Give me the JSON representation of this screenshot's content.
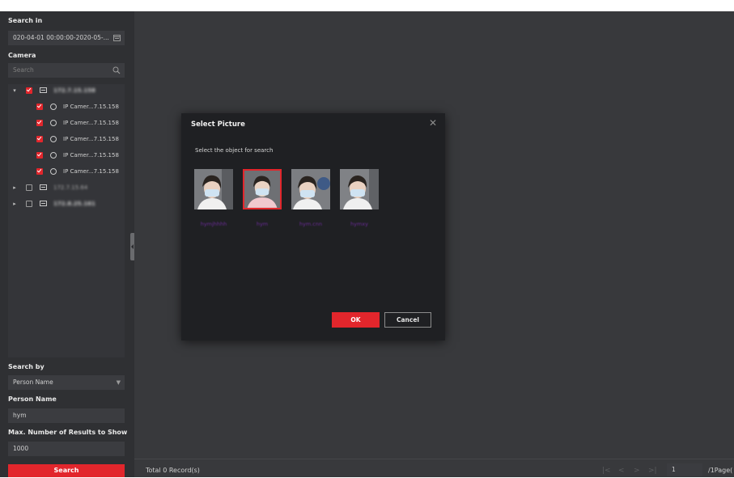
{
  "sidebar": {
    "search_in_label": "Search in",
    "date_range": "020-04-01 00:00:00-2020-05-...",
    "camera_label": "Camera",
    "camera_search_placeholder": "Search",
    "tree": [
      {
        "label": "172.7.15.158",
        "type": "folder",
        "expanded": true,
        "checked": true,
        "level": 0
      },
      {
        "label": "IP Camer...7.15.158",
        "type": "camera",
        "checked": true,
        "level": 1
      },
      {
        "label": "IP Camer...7.15.158",
        "type": "camera",
        "checked": true,
        "level": 1
      },
      {
        "label": "IP Camer...7.15.158",
        "type": "camera",
        "checked": true,
        "level": 1
      },
      {
        "label": "IP Camer...7.15.158",
        "type": "camera",
        "checked": true,
        "level": 1
      },
      {
        "label": "IP Camer...7.15.158",
        "type": "camera",
        "checked": true,
        "level": 1
      },
      {
        "label": "172.7.15.64",
        "type": "folder",
        "expanded": false,
        "checked": false,
        "level": 0
      },
      {
        "label": "172.8.25.161",
        "type": "folder",
        "expanded": false,
        "checked": false,
        "level": 0
      }
    ],
    "search_by_label": "Search by",
    "search_by_value": "Person Name",
    "person_name_label": "Person Name",
    "person_name_value": "hym",
    "max_results_label": "Max. Number of Results to Show",
    "max_results_value": "1000",
    "search_button": "Search"
  },
  "footer": {
    "total_records": "Total 0 Record(s)",
    "page_value": "1",
    "page_count": "/1Page("
  },
  "dialog": {
    "title": "Select Picture",
    "hint": "Select the object for search",
    "pictures": [
      {
        "label": "hymjhhhh",
        "selected": false
      },
      {
        "label": "hym",
        "selected": true
      },
      {
        "label": "hym.cnn",
        "selected": false
      },
      {
        "label": "hymxy",
        "selected": false
      }
    ],
    "ok_button": "OK",
    "cancel_button": "Cancel"
  },
  "colors": {
    "accent": "#e2262c",
    "sidebar_bg": "#2f3033",
    "main_bg": "#38393c",
    "dialog_bg": "#1f2023",
    "picture_label": "#6a2c96"
  },
  "icons": {
    "calendar": "calendar-icon",
    "search": "search-icon",
    "close": "close-icon",
    "dropdown": "caret-down-icon"
  }
}
